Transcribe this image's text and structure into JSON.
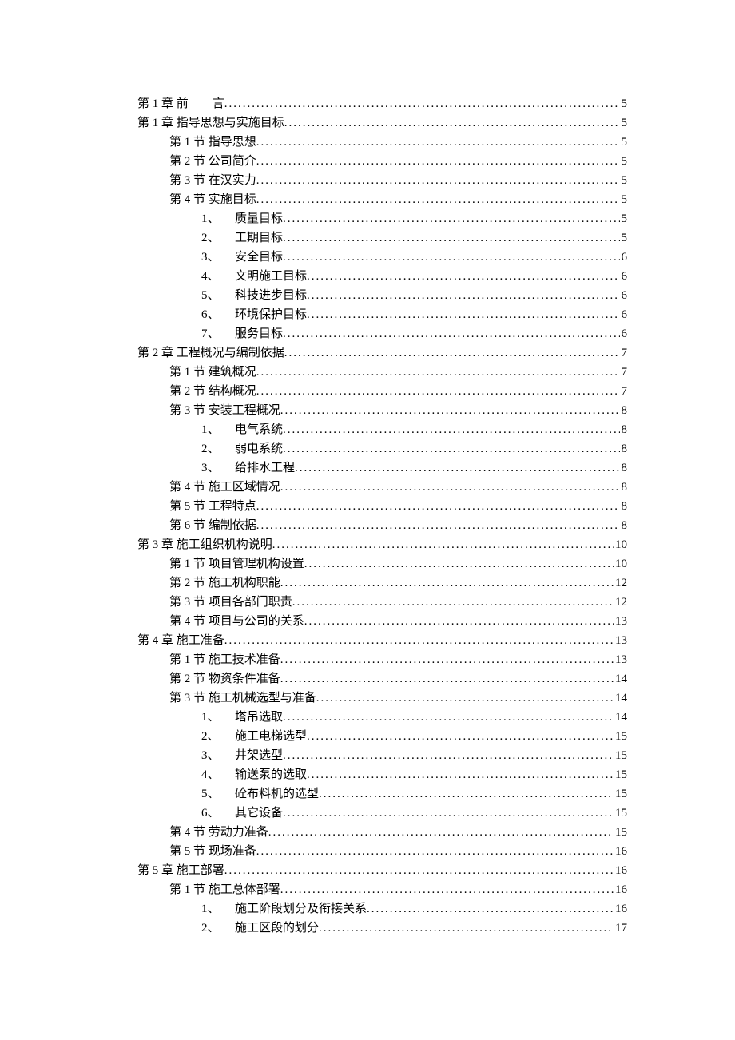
{
  "toc": [
    {
      "level": 1,
      "label": "第 1 章 前　　言",
      "page": "5"
    },
    {
      "level": 1,
      "label": "第 1 章 指导思想与实施目标",
      "page": "5"
    },
    {
      "level": 2,
      "label": "第 1 节 指导思想",
      "page": "5"
    },
    {
      "level": 2,
      "label": "第 2 节 公司简介",
      "page": "5"
    },
    {
      "level": 2,
      "label": "第 3 节 在汉实力",
      "page": "5"
    },
    {
      "level": 2,
      "label": "第 4 节 实施目标",
      "page": "5"
    },
    {
      "level": 3,
      "num": "1、",
      "label": "质量目标",
      "page": "5"
    },
    {
      "level": 3,
      "num": "2、",
      "label": "工期目标",
      "page": "5"
    },
    {
      "level": 3,
      "num": "3、",
      "label": "安全目标",
      "page": "6"
    },
    {
      "level": 3,
      "num": "4、",
      "label": "文明施工目标",
      "page": "6"
    },
    {
      "level": 3,
      "num": "5、",
      "label": "科技进步目标",
      "page": "6"
    },
    {
      "level": 3,
      "num": "6、",
      "label": "环境保护目标",
      "page": "6"
    },
    {
      "level": 3,
      "num": "7、",
      "label": "服务目标",
      "page": "6"
    },
    {
      "level": 1,
      "label": "第 2 章 工程概况与编制依据",
      "page": "7"
    },
    {
      "level": 2,
      "label": "第 1 节 建筑概况",
      "page": "7"
    },
    {
      "level": 2,
      "label": "第 2 节 结构概况",
      "page": "7"
    },
    {
      "level": 2,
      "label": "第 3 节 安装工程概况",
      "page": "8"
    },
    {
      "level": 3,
      "num": "1、",
      "label": "电气系统",
      "page": "8"
    },
    {
      "level": 3,
      "num": "2、",
      "label": "弱电系统",
      "page": "8"
    },
    {
      "level": 3,
      "num": "3、",
      "label": "给排水工程",
      "page": "8"
    },
    {
      "level": 2,
      "label": "第 4 节 施工区域情况",
      "page": "8"
    },
    {
      "level": 2,
      "label": "第 5 节 工程特点",
      "page": "8"
    },
    {
      "level": 2,
      "label": "第 6 节 编制依据",
      "page": "8"
    },
    {
      "level": 1,
      "label": "第 3 章 施工组织机构说明",
      "page": "10"
    },
    {
      "level": 2,
      "label": "第 1 节 项目管理机构设置",
      "page": "10"
    },
    {
      "level": 2,
      "label": "第 2 节 施工机构职能",
      "page": "12"
    },
    {
      "level": 2,
      "label": "第 3 节 项目各部门职责",
      "page": "12"
    },
    {
      "level": 2,
      "label": "第 4 节 项目与公司的关系",
      "page": "13"
    },
    {
      "level": 1,
      "label": "第 4 章 施工准备",
      "page": "13"
    },
    {
      "level": 2,
      "label": "第 1 节 施工技术准备",
      "page": "13"
    },
    {
      "level": 2,
      "label": "第 2 节 物资条件准备",
      "page": "14"
    },
    {
      "level": 2,
      "label": "第 3 节 施工机械选型与准备",
      "page": "14"
    },
    {
      "level": 3,
      "num": "1、",
      "label": "塔吊选取",
      "page": "14"
    },
    {
      "level": 3,
      "num": "2、",
      "label": "施工电梯选型",
      "page": "15"
    },
    {
      "level": 3,
      "num": "3、",
      "label": "井架选型",
      "page": "15"
    },
    {
      "level": 3,
      "num": "4、",
      "label": "输送泵的选取",
      "page": "15"
    },
    {
      "level": 3,
      "num": "5、",
      "label": "砼布料机的选型",
      "page": "15"
    },
    {
      "level": 3,
      "num": "6、",
      "label": "其它设备",
      "page": "15"
    },
    {
      "level": 2,
      "label": "第 4 节 劳动力准备",
      "page": "15"
    },
    {
      "level": 2,
      "label": "第 5 节 现场准备",
      "page": "16"
    },
    {
      "level": 1,
      "label": "第 5 章 施工部署",
      "page": "16"
    },
    {
      "level": 2,
      "label": "第 1 节 施工总体部署",
      "page": "16"
    },
    {
      "level": 3,
      "num": "1、",
      "label": "施工阶段划分及衔接关系",
      "page": "16"
    },
    {
      "level": 3,
      "num": "2、",
      "label": "施工区段的划分",
      "page": "17"
    }
  ]
}
